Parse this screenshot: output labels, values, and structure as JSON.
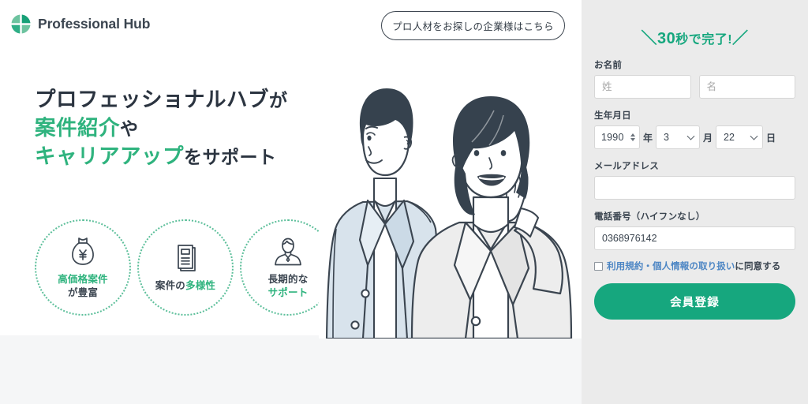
{
  "brand": {
    "name": "Professional Hub",
    "logo_icon": "quadrant-circle-icon",
    "accent_green": "#16a77e",
    "headline_green": "#2fb37e",
    "text_dark": "#3b4550"
  },
  "header": {
    "cta_label": "プロ人材をお探しの企業様はこちら"
  },
  "hero": {
    "headline": {
      "line1_plain": "プロフェッショナルハブ",
      "line1_suffix": "が",
      "line2_green": "案件紹介",
      "line2_suffix": "や",
      "line3_green": "キャリアアップ",
      "line3_suffix": "をサポート"
    },
    "features": [
      {
        "icon": "money-bag-yen-icon",
        "label_green": "高価格案件",
        "label_dark": "が豊富",
        "green_first": true
      },
      {
        "icon": "documents-icon",
        "label_dark": "案件の",
        "label_green": "多様性",
        "green_first": false
      },
      {
        "icon": "person-support-icon",
        "label_dark": "長期的な",
        "label_green": "サポート",
        "green_first": false
      }
    ],
    "illustration_alt": "business-man-and-woman-illustration"
  },
  "form": {
    "title_slash_open": "＼",
    "title_number": "30",
    "title_rest": "秒で完了!",
    "title_slash_close": "／",
    "name": {
      "label": "お名前",
      "last_placeholder": "姓",
      "last_value": "",
      "first_placeholder": "名",
      "first_value": ""
    },
    "birthdate": {
      "label": "生年月日",
      "year_value": "1990",
      "year_unit": "年",
      "month_value": "3",
      "month_unit": "月",
      "day_value": "22",
      "day_unit": "日"
    },
    "email": {
      "label": "メールアドレス",
      "value": "",
      "placeholder": ""
    },
    "phone": {
      "label": "電話番号（ハイフンなし）",
      "value": "0368976142",
      "placeholder": ""
    },
    "agreement": {
      "link_text": "利用規約・個人情報の取り扱い",
      "rest_text": "に同意する",
      "checked": false
    },
    "submit_label": "会員登録"
  }
}
